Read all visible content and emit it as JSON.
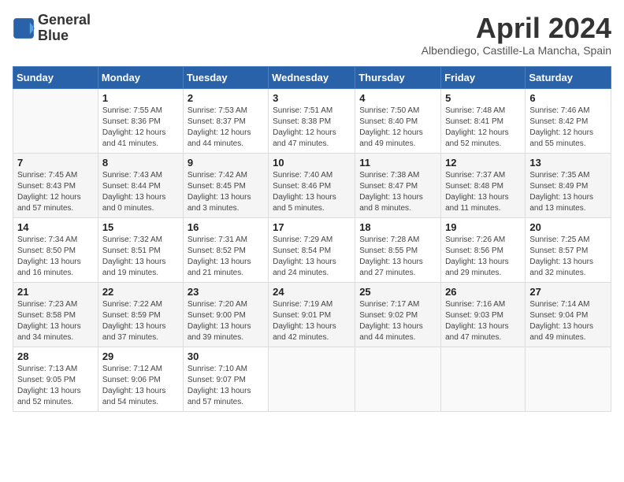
{
  "header": {
    "logo_line1": "General",
    "logo_line2": "Blue",
    "month_year": "April 2024",
    "location": "Albendiego, Castille-La Mancha, Spain"
  },
  "weekdays": [
    "Sunday",
    "Monday",
    "Tuesday",
    "Wednesday",
    "Thursday",
    "Friday",
    "Saturday"
  ],
  "weeks": [
    [
      {
        "num": "",
        "empty": true
      },
      {
        "num": "1",
        "sunrise": "7:55 AM",
        "sunset": "8:36 PM",
        "daylight": "12 hours and 41 minutes."
      },
      {
        "num": "2",
        "sunrise": "7:53 AM",
        "sunset": "8:37 PM",
        "daylight": "12 hours and 44 minutes."
      },
      {
        "num": "3",
        "sunrise": "7:51 AM",
        "sunset": "8:38 PM",
        "daylight": "12 hours and 47 minutes."
      },
      {
        "num": "4",
        "sunrise": "7:50 AM",
        "sunset": "8:40 PM",
        "daylight": "12 hours and 49 minutes."
      },
      {
        "num": "5",
        "sunrise": "7:48 AM",
        "sunset": "8:41 PM",
        "daylight": "12 hours and 52 minutes."
      },
      {
        "num": "6",
        "sunrise": "7:46 AM",
        "sunset": "8:42 PM",
        "daylight": "12 hours and 55 minutes."
      }
    ],
    [
      {
        "num": "7",
        "sunrise": "7:45 AM",
        "sunset": "8:43 PM",
        "daylight": "12 hours and 57 minutes."
      },
      {
        "num": "8",
        "sunrise": "7:43 AM",
        "sunset": "8:44 PM",
        "daylight": "13 hours and 0 minutes."
      },
      {
        "num": "9",
        "sunrise": "7:42 AM",
        "sunset": "8:45 PM",
        "daylight": "13 hours and 3 minutes."
      },
      {
        "num": "10",
        "sunrise": "7:40 AM",
        "sunset": "8:46 PM",
        "daylight": "13 hours and 5 minutes."
      },
      {
        "num": "11",
        "sunrise": "7:38 AM",
        "sunset": "8:47 PM",
        "daylight": "13 hours and 8 minutes."
      },
      {
        "num": "12",
        "sunrise": "7:37 AM",
        "sunset": "8:48 PM",
        "daylight": "13 hours and 11 minutes."
      },
      {
        "num": "13",
        "sunrise": "7:35 AM",
        "sunset": "8:49 PM",
        "daylight": "13 hours and 13 minutes."
      }
    ],
    [
      {
        "num": "14",
        "sunrise": "7:34 AM",
        "sunset": "8:50 PM",
        "daylight": "13 hours and 16 minutes."
      },
      {
        "num": "15",
        "sunrise": "7:32 AM",
        "sunset": "8:51 PM",
        "daylight": "13 hours and 19 minutes."
      },
      {
        "num": "16",
        "sunrise": "7:31 AM",
        "sunset": "8:52 PM",
        "daylight": "13 hours and 21 minutes."
      },
      {
        "num": "17",
        "sunrise": "7:29 AM",
        "sunset": "8:54 PM",
        "daylight": "13 hours and 24 minutes."
      },
      {
        "num": "18",
        "sunrise": "7:28 AM",
        "sunset": "8:55 PM",
        "daylight": "13 hours and 27 minutes."
      },
      {
        "num": "19",
        "sunrise": "7:26 AM",
        "sunset": "8:56 PM",
        "daylight": "13 hours and 29 minutes."
      },
      {
        "num": "20",
        "sunrise": "7:25 AM",
        "sunset": "8:57 PM",
        "daylight": "13 hours and 32 minutes."
      }
    ],
    [
      {
        "num": "21",
        "sunrise": "7:23 AM",
        "sunset": "8:58 PM",
        "daylight": "13 hours and 34 minutes."
      },
      {
        "num": "22",
        "sunrise": "7:22 AM",
        "sunset": "8:59 PM",
        "daylight": "13 hours and 37 minutes."
      },
      {
        "num": "23",
        "sunrise": "7:20 AM",
        "sunset": "9:00 PM",
        "daylight": "13 hours and 39 minutes."
      },
      {
        "num": "24",
        "sunrise": "7:19 AM",
        "sunset": "9:01 PM",
        "daylight": "13 hours and 42 minutes."
      },
      {
        "num": "25",
        "sunrise": "7:17 AM",
        "sunset": "9:02 PM",
        "daylight": "13 hours and 44 minutes."
      },
      {
        "num": "26",
        "sunrise": "7:16 AM",
        "sunset": "9:03 PM",
        "daylight": "13 hours and 47 minutes."
      },
      {
        "num": "27",
        "sunrise": "7:14 AM",
        "sunset": "9:04 PM",
        "daylight": "13 hours and 49 minutes."
      }
    ],
    [
      {
        "num": "28",
        "sunrise": "7:13 AM",
        "sunset": "9:05 PM",
        "daylight": "13 hours and 52 minutes."
      },
      {
        "num": "29",
        "sunrise": "7:12 AM",
        "sunset": "9:06 PM",
        "daylight": "13 hours and 54 minutes."
      },
      {
        "num": "30",
        "sunrise": "7:10 AM",
        "sunset": "9:07 PM",
        "daylight": "13 hours and 57 minutes."
      },
      {
        "num": "",
        "empty": true
      },
      {
        "num": "",
        "empty": true
      },
      {
        "num": "",
        "empty": true
      },
      {
        "num": "",
        "empty": true
      }
    ]
  ],
  "labels": {
    "sunrise_prefix": "Sunrise: ",
    "sunset_prefix": "Sunset: ",
    "daylight_prefix": "Daylight: "
  }
}
